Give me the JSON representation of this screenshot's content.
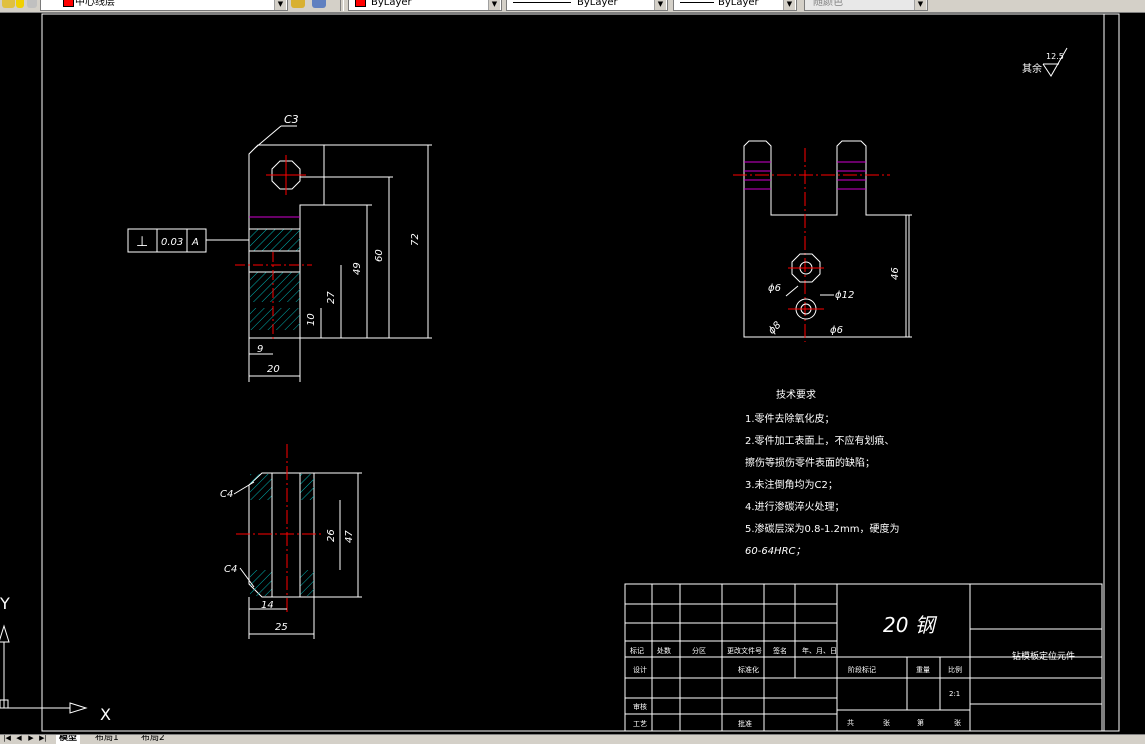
{
  "toolbar": {
    "layer_name": "中心线层",
    "color_control": "ByLayer",
    "linetype_control": "ByLayer",
    "lineweight_control": "ByLayer",
    "plotstyle_control": "随颜色",
    "layer_color": "#ff0000"
  },
  "drawing": {
    "surface_roughness_label": "其余",
    "surface_roughness_value": "12.5",
    "front_view": {
      "chamfer": "C3",
      "tolerance_symbol": "⊥",
      "tolerance_value": "0.03",
      "datum": "A",
      "dim_72": "72",
      "dim_60": "60",
      "dim_49": "49",
      "dim_27": "27",
      "dim_10": "10",
      "dim_9": "9",
      "dim_20": "20"
    },
    "side_view": {
      "dim_46": "46",
      "dim_phi6_left": "ϕ6",
      "dim_phi12": "ϕ12",
      "dim_phi8": "ϕ8",
      "dim_phi6_right": "ϕ6"
    },
    "section_view": {
      "chamfer_top": "C4",
      "chamfer_bottom": "C4",
      "dim_26": "26",
      "dim_47": "47",
      "dim_14": "14",
      "dim_25": "25"
    },
    "technical_requirements": {
      "heading": "技术要求",
      "lines": [
        "1.零件去除氧化皮；",
        "2.零件加工表面上，不应有划痕、",
        "   擦伤等损伤零件表面的缺陷；",
        "3.未注倒角均为C2；",
        "4.进行渗碳淬火处理；",
        "5.渗碳层深为0.8-1.2mm，硬度为",
        "60-64HRC；"
      ]
    },
    "title_block": {
      "material": "20 钢",
      "part_name": "钻模板定位元件",
      "header_mark": "标记",
      "header_count": "处数",
      "header_zone": "分区",
      "header_doc": "更改文件号",
      "header_sign": "签名",
      "header_date": "年、月、日",
      "row_design": "设计",
      "row_standard": "标准化",
      "row_review": "审核",
      "row_process": "工艺",
      "row_approve": "批准",
      "stage_mark": "阶段标记",
      "weight": "重量",
      "scale_label": "比例",
      "scale_value": "2:1",
      "sheets_total": "共",
      "sheets_total_unit": "张",
      "sheet_no": "第",
      "sheet_no_unit": "张"
    }
  },
  "ucs": {
    "x_label": "X",
    "y_label": "Y"
  },
  "layout_tabs": {
    "model": "模型",
    "layout1": "布局1",
    "layout2": "布局2"
  }
}
